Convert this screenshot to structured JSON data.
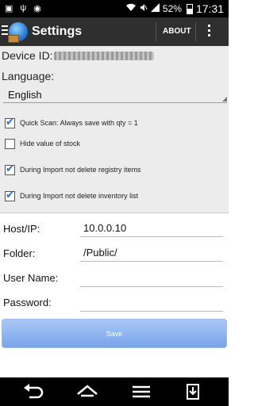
{
  "status_bar": {
    "battery": "52%",
    "time": "17:31",
    "battery_level": 0.52,
    "icons": [
      "image-icon",
      "usb-icon",
      "bug-icon",
      "wifi-icon",
      "mute-icon",
      "signal-icon",
      "battery-icon"
    ]
  },
  "action_bar": {
    "title": "Settings",
    "about": "ABOUT",
    "icons": [
      "menu-icon",
      "app-icon",
      "overflow-icon"
    ]
  },
  "settings": {
    "device_id_label": "Device ID:",
    "language_label": "Language:",
    "language_value": "English",
    "checkboxes": [
      {
        "label": "Quick Scan: Always save with qty = 1",
        "checked": true
      },
      {
        "label": "Hide value of stock",
        "checked": false
      },
      {
        "label": "During Import not delete registry items",
        "checked": true
      },
      {
        "label": "During Import not delete inventory list",
        "checked": true
      }
    ]
  },
  "form": {
    "host_label": "Host/IP:",
    "host_value": "10.0.0.10",
    "folder_label": "Folder:",
    "folder_value": "/Public/",
    "user_label": "User Name:",
    "user_value": "",
    "password_label": "Password:",
    "password_value": "",
    "save_label": "Save"
  },
  "nav_bar": {
    "icons": [
      "back-icon",
      "home-icon",
      "recent-apps-icon",
      "download-icon"
    ]
  },
  "colors": {
    "action_bar": "#2f2f2f",
    "settings_bg": "#ececec",
    "checkbox_accent": "#1f6fd4",
    "save_button": "#8fb3ef"
  }
}
